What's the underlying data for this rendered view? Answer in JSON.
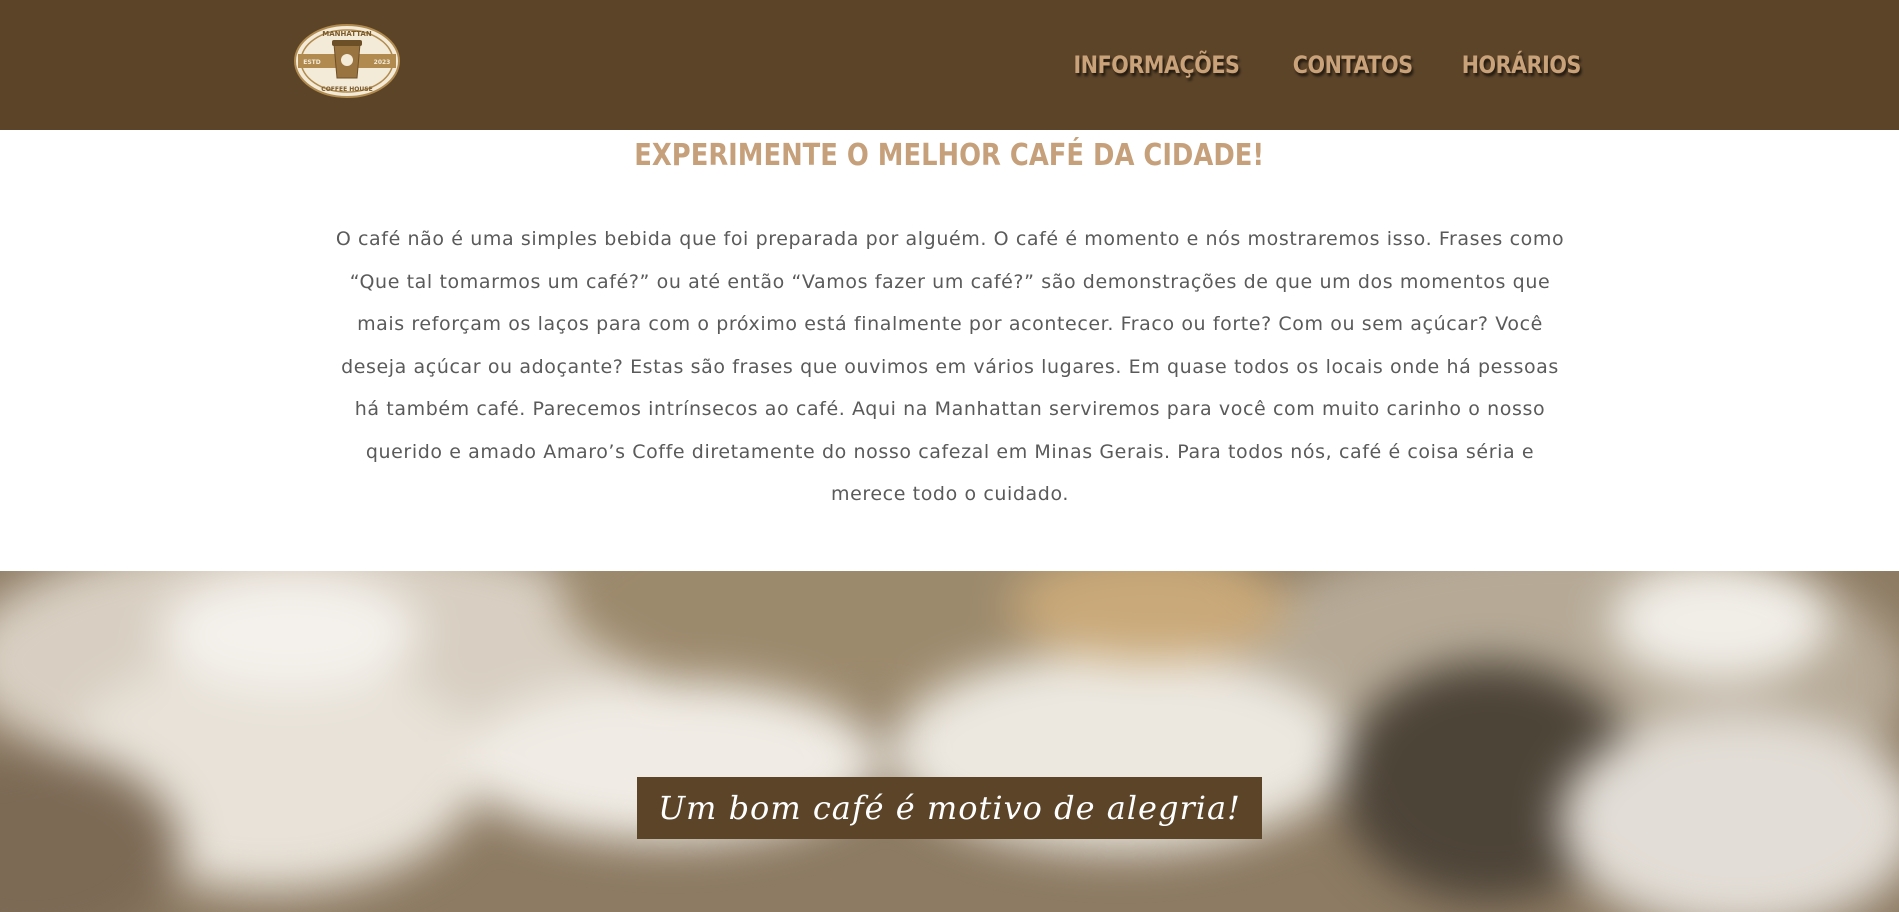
{
  "header": {
    "logo": {
      "top_text": "MANHATTAN",
      "left_text": "ESTD",
      "right_text": "2023",
      "bottom_text": "COFFEE HOUSE",
      "icon": "coffee-cup-icon"
    },
    "nav": [
      {
        "label": "INFORMAÇÕES"
      },
      {
        "label": "CONTATOS"
      },
      {
        "label": "HORÁRIOS"
      }
    ]
  },
  "main": {
    "headline": "EXPERIMENTE O MELHOR CAFÉ DA CIDADE!",
    "paragraph": "O café não é uma simples bebida que foi preparada por alguém. O café é momento e nós mostraremos isso. Frases como “Que tal tomarmos um café?” ou até então “Vamos fazer um café?” são demonstrações de que um dos momentos que mais reforçam os laços para com o próximo está finalmente por acontecer. Fraco ou forte? Com ou sem açúcar? Você deseja açúcar ou adoçante? Estas são frases que ouvimos em vários lugares. Em quase todos os locais onde há pessoas há também café. Parecemos intrínsecos ao café. Aqui na Manhattan serviremos para você com muito carinho o nosso querido e amado Amaro’s Coffe diretamente do nosso cafezal em Minas Gerais. Para todos nós, café é coisa séria e merece todo o cuidado."
  },
  "hero": {
    "banner_text": "Um bom café é motivo de alegria!"
  },
  "colors": {
    "header_bg": "#5c4429",
    "nav_text": "#c9a27a",
    "headline": "#c6a07a",
    "body_text": "#5a5a5a",
    "banner_bg": "#5c4429"
  }
}
